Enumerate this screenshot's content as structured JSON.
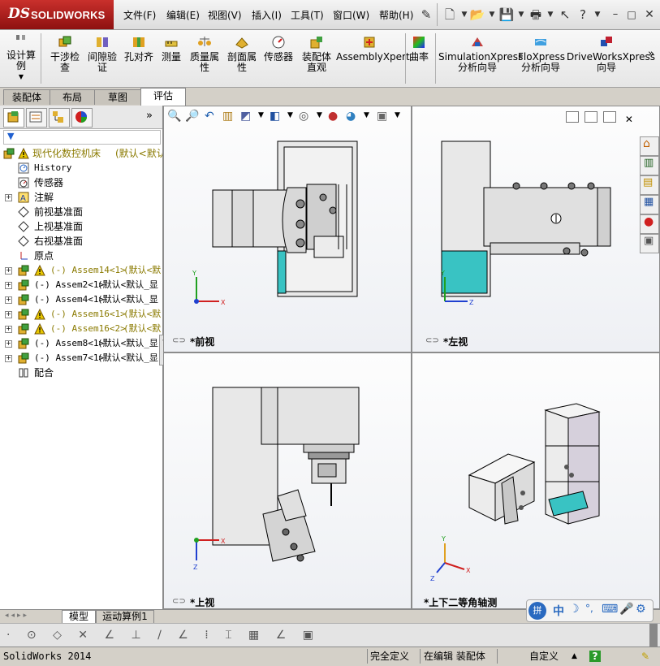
{
  "app": {
    "logo_ds": "DS",
    "logo_name": "SOLIDWORKS"
  },
  "menu": [
    "文件(F)",
    "编辑(E)",
    "视图(V)",
    "插入(I)",
    "工具(T)",
    "窗口(W)",
    "帮助(H)"
  ],
  "commands": [
    {
      "label": "设计算\n例",
      "icon": "design-study-icon"
    },
    {
      "label": "干涉检\n查",
      "icon": "interference-check-icon"
    },
    {
      "label": "间隙验\n证",
      "icon": "clearance-verify-icon"
    },
    {
      "label": "孔对齐",
      "icon": "hole-align-icon"
    },
    {
      "label": "测量",
      "icon": "measure-icon"
    },
    {
      "label": "质量属\n性",
      "icon": "mass-properties-icon"
    },
    {
      "label": "剖面属\n性",
      "icon": "section-properties-icon"
    },
    {
      "label": "传感器",
      "icon": "sensor-icon"
    },
    {
      "label": "装配体\n直观",
      "icon": "assembly-visualization-icon"
    },
    {
      "label": "AssemblyXpert",
      "icon": "assemblyxpert-icon"
    },
    {
      "label": "曲率",
      "icon": "curvature-icon"
    },
    {
      "label": "SimulationXpress\n分析向导",
      "icon": "simulationxpress-icon"
    },
    {
      "label": "FloXpress\n分析向导",
      "icon": "floxpress-icon"
    },
    {
      "label": "DriveWorksXpress\n向导",
      "icon": "driveworksxpress-icon"
    }
  ],
  "tabs": [
    "装配体",
    "布局",
    "草图",
    "评估"
  ],
  "active_tab": "评估",
  "tree": {
    "root": "现代化数控机床",
    "root_config": "(默认<默认",
    "items": [
      {
        "label": "History",
        "kind": "history",
        "mono": true
      },
      {
        "label": "传感器",
        "kind": "sensor"
      },
      {
        "label": "注解",
        "kind": "annotation",
        "expand": true
      },
      {
        "label": "前视基准面",
        "kind": "plane"
      },
      {
        "label": "上视基准面",
        "kind": "plane"
      },
      {
        "label": "右视基准面",
        "kind": "plane"
      },
      {
        "label": "原点",
        "kind": "origin"
      },
      {
        "label": "(-) Assem14<1>",
        "config": "(默认<默",
        "kind": "assem-warn",
        "expand": true
      },
      {
        "label": "(-) Assem2<1>",
        "config": "(默认<默认_显",
        "kind": "assem",
        "expand": true
      },
      {
        "label": "(-) Assem4<1>",
        "config": "(默认<默认_显",
        "kind": "assem",
        "expand": true
      },
      {
        "label": "(-) Assem16<1>",
        "config": "(默认<默",
        "kind": "assem-warn",
        "expand": true
      },
      {
        "label": "(-) Assem16<2>",
        "config": "(默认<默",
        "kind": "assem-warn",
        "expand": true
      },
      {
        "label": "(-) Assem8<1>",
        "config": "(默认<默认_显",
        "kind": "assem",
        "expand": true
      },
      {
        "label": "(-) Assem7<1>",
        "config": "(默认<默认_显",
        "kind": "assem",
        "expand": true
      },
      {
        "label": "配合",
        "kind": "mates"
      }
    ]
  },
  "views": {
    "front": "*前视",
    "left": "*左视",
    "top": "*上视",
    "iso": "*上下二等角轴测"
  },
  "bottom_tabs": [
    "模型",
    "运动算例1"
  ],
  "status": {
    "app_version": "SolidWorks 2014",
    "definition": "完全定义",
    "mode": "在编辑 装配体",
    "custom": "自定义"
  },
  "colors": {
    "brand": "#b01e1e",
    "axis_x": "#d02020",
    "axis_y": "#20a020",
    "axis_z": "#2040d0",
    "cyan_part": "#39c3c3",
    "warning": "#e8c800"
  },
  "ime": {
    "label": "中"
  }
}
